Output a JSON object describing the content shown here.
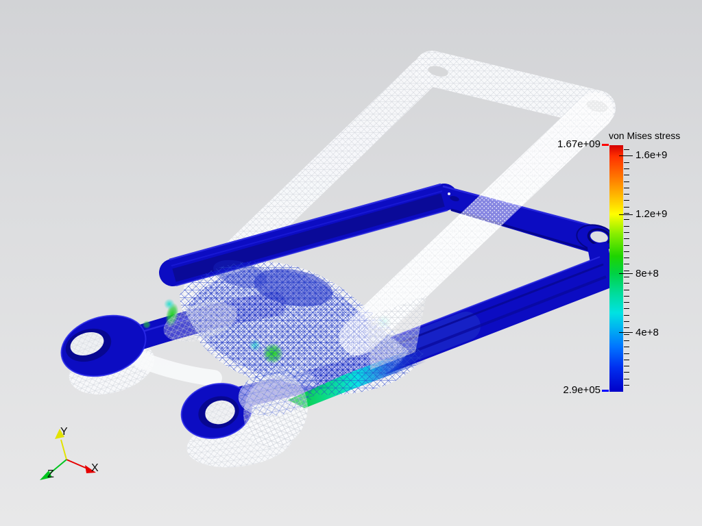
{
  "legend": {
    "title": "von Mises stress",
    "max_label": "1.67e+09",
    "min_label": "2.9e+05",
    "range": {
      "min": 290000,
      "max": 1670000000
    },
    "max_dash_color": "#ff0000",
    "min_dash_color": "#0000ff",
    "ticks": [
      {
        "label": "1.6e+9",
        "value": 1600000000
      },
      {
        "label": "1.2e+9",
        "value": 1200000000
      },
      {
        "label": "8e+8",
        "value": 800000000
      },
      {
        "label": "4e+8",
        "value": 400000000
      }
    ],
    "minor_tick_count": 38,
    "colormap": [
      {
        "pos": 0.0,
        "color": "#d40000"
      },
      {
        "pos": 0.045,
        "color": "#ff3000"
      },
      {
        "pos": 0.15,
        "color": "#ff8800"
      },
      {
        "pos": 0.24,
        "color": "#ffd800"
      },
      {
        "pos": 0.28,
        "color": "#ffff00"
      },
      {
        "pos": 0.36,
        "color": "#88ee00"
      },
      {
        "pos": 0.45,
        "color": "#1fd400"
      },
      {
        "pos": 0.52,
        "color": "#00d244"
      },
      {
        "pos": 0.6,
        "color": "#00dc9a"
      },
      {
        "pos": 0.68,
        "color": "#00e2e2"
      },
      {
        "pos": 0.74,
        "color": "#00b4f0"
      },
      {
        "pos": 0.82,
        "color": "#0072ff"
      },
      {
        "pos": 0.9,
        "color": "#0030f0"
      },
      {
        "pos": 1.0,
        "color": "#0000c8"
      }
    ]
  },
  "axes_widget": {
    "x": {
      "label": "X",
      "color": "#e60000"
    },
    "y": {
      "label": "Y",
      "color": "#e2e200"
    },
    "z": {
      "label": "Z",
      "color": "#00c41e"
    }
  },
  "colors": {
    "deformed": "#0c0cc2",
    "deformed_dark": "#050585",
    "deformed_bright": "#2a2ae0",
    "wireframe": "#f8f9fb",
    "bg_top": "#d2d3d6",
    "bg_bottom": "#e8e8e9",
    "hotspot_green": "#18d018",
    "hotspot_teal": "#00dcc8"
  }
}
